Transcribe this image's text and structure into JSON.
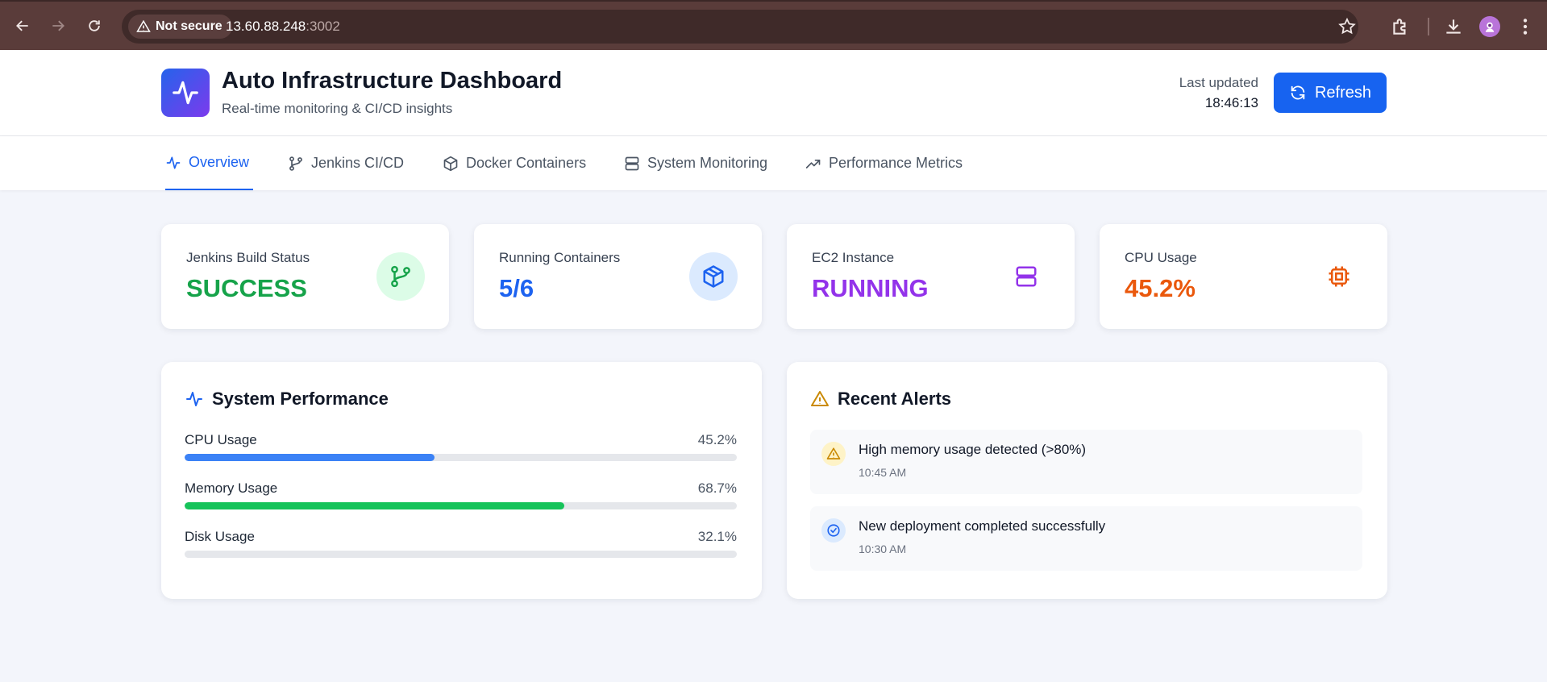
{
  "browser": {
    "security_label": "Not secure",
    "url_host": "13.60.88.248",
    "url_port": ":3002"
  },
  "header": {
    "title": "Auto Infrastructure Dashboard",
    "subtitle": "Real-time monitoring & CI/CD insights",
    "last_updated_label": "Last updated",
    "last_updated_time": "18:46:13",
    "refresh_label": "Refresh"
  },
  "tabs": [
    {
      "label": "Overview",
      "icon": "activity-icon",
      "active": true
    },
    {
      "label": "Jenkins CI/CD",
      "icon": "git-branch-icon",
      "active": false
    },
    {
      "label": "Docker Containers",
      "icon": "box-icon",
      "active": false
    },
    {
      "label": "System Monitoring",
      "icon": "server-icon",
      "active": false
    },
    {
      "label": "Performance Metrics",
      "icon": "trending-up-icon",
      "active": false
    }
  ],
  "stats": [
    {
      "label": "Jenkins Build Status",
      "value": "SUCCESS",
      "color": "#16a34a",
      "icon": "git-branch-icon",
      "icon_bg": "#dcfce7"
    },
    {
      "label": "Running Containers",
      "value": "5/6",
      "color": "#1d63f0",
      "icon": "box-icon",
      "icon_bg": "#dbeafe"
    },
    {
      "label": "EC2 Instance",
      "value": "RUNNING",
      "color": "#9333ea",
      "icon": "server-icon",
      "icon_bg": "#ffffff"
    },
    {
      "label": "CPU Usage",
      "value": "45.2%",
      "color": "#ea580c",
      "icon": "cpu-icon",
      "icon_bg": "#ffffff"
    }
  ],
  "performance": {
    "title": "System Performance",
    "metrics": [
      {
        "name": "CPU Usage",
        "value": "45.2%",
        "percent": 45.2,
        "color": "#3b82f6"
      },
      {
        "name": "Memory Usage",
        "value": "68.7%",
        "percent": 68.7,
        "color": "#16c35a"
      },
      {
        "name": "Disk Usage",
        "value": "32.1%",
        "percent": 32.1,
        "color": "#e5e7eb"
      }
    ]
  },
  "alerts": {
    "title": "Recent Alerts",
    "items": [
      {
        "message": "High memory usage detected (>80%)",
        "time": "10:45 AM",
        "icon": "warning-icon",
        "icon_bg": "#fef3c7",
        "icon_color": "#ca8a04"
      },
      {
        "message": "New deployment completed successfully",
        "time": "10:30 AM",
        "icon": "check-circle-icon",
        "icon_bg": "#dbeafe",
        "icon_color": "#1d63f0"
      }
    ]
  },
  "colors": {
    "accent": "#1763f0",
    "browser_bar": "#5a3c3a"
  }
}
